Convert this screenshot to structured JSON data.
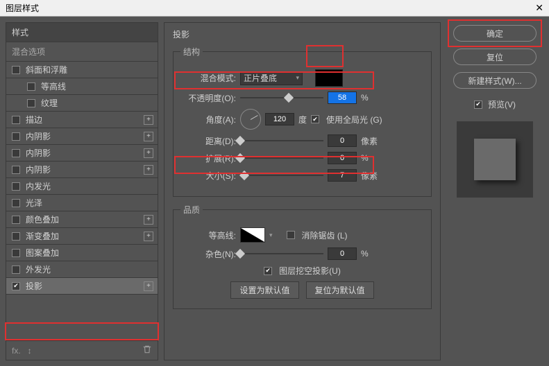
{
  "window": {
    "title": "图层样式",
    "close": "✕"
  },
  "left": {
    "header": "样式",
    "blend": "混合选项",
    "items": [
      {
        "label": "斜面和浮雕",
        "checked": false,
        "plus": false,
        "indent": false
      },
      {
        "label": "等高线",
        "checked": false,
        "plus": false,
        "indent": true
      },
      {
        "label": "纹理",
        "checked": false,
        "plus": false,
        "indent": true
      },
      {
        "label": "描边",
        "checked": false,
        "plus": true,
        "indent": false
      },
      {
        "label": "内阴影",
        "checked": false,
        "plus": true,
        "indent": false
      },
      {
        "label": "内阴影",
        "checked": false,
        "plus": true,
        "indent": false
      },
      {
        "label": "内阴影",
        "checked": false,
        "plus": true,
        "indent": false
      },
      {
        "label": "内发光",
        "checked": false,
        "plus": false,
        "indent": false
      },
      {
        "label": "光泽",
        "checked": false,
        "plus": false,
        "indent": false
      },
      {
        "label": "颜色叠加",
        "checked": false,
        "plus": true,
        "indent": false
      },
      {
        "label": "渐变叠加",
        "checked": false,
        "plus": true,
        "indent": false
      },
      {
        "label": "图案叠加",
        "checked": false,
        "plus": false,
        "indent": false
      },
      {
        "label": "外发光",
        "checked": false,
        "plus": false,
        "indent": false
      },
      {
        "label": "投影",
        "checked": true,
        "plus": true,
        "indent": false,
        "selected": true
      }
    ]
  },
  "center": {
    "title": "投影",
    "structure": "结构",
    "blendmode_label": "混合模式:",
    "blendmode_value": "正片叠底",
    "opacity_label": "不透明度(O):",
    "opacity_value": "58",
    "opacity_unit": "%",
    "angle_label": "角度(A):",
    "angle_value": "120",
    "angle_unit": "度",
    "global_light": "使用全局光 (G)",
    "distance_label": "距离(D):",
    "distance_value": "0",
    "distance_unit": "像素",
    "spread_label": "扩展(R):",
    "spread_value": "0",
    "spread_unit": "%",
    "size_label": "大小(S):",
    "size_value": "7",
    "size_unit": "像素",
    "quality": "品质",
    "contour_label": "等高线:",
    "antialias": "消除锯齿 (L)",
    "noise_label": "杂色(N):",
    "noise_value": "0",
    "noise_unit": "%",
    "knockout": "图层挖空投影(U)",
    "default_set": "设置为默认值",
    "default_reset": "复位为默认值"
  },
  "right": {
    "ok": "确定",
    "cancel": "复位",
    "newstyle": "新建样式(W)...",
    "preview": "预览(V)"
  }
}
